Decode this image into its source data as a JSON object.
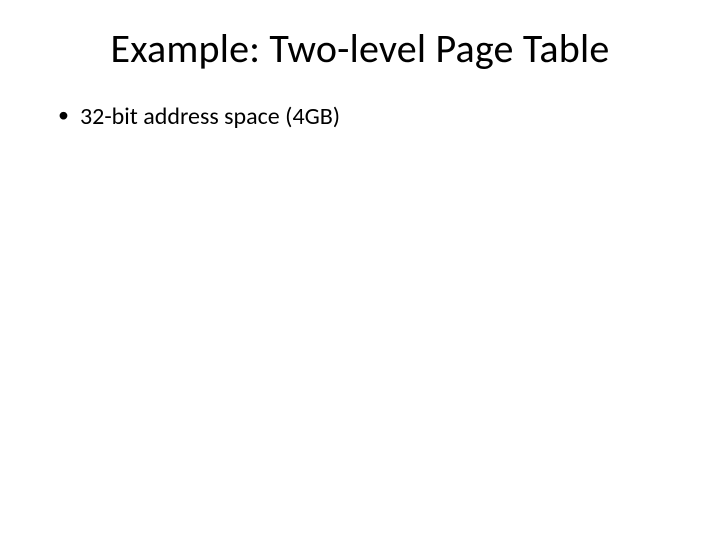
{
  "slide": {
    "title": "Example: Two-level Page Table",
    "bullets": [
      "32-bit address space (4GB)"
    ]
  }
}
